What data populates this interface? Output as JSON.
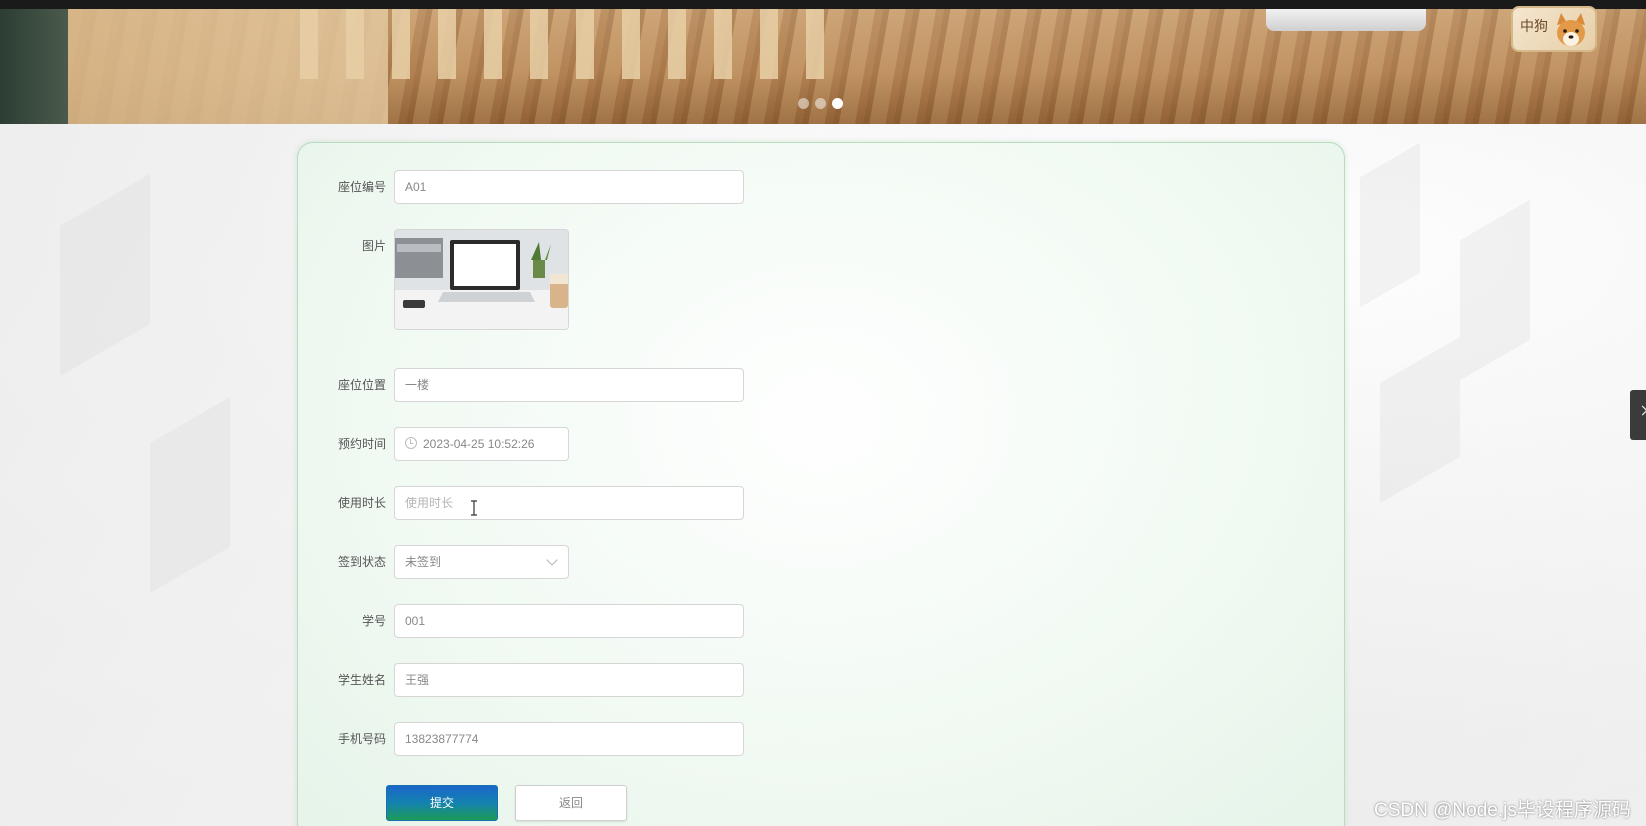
{
  "banner": {
    "slide_count": 3,
    "active_slide": 3
  },
  "logo": {
    "text": "中狗"
  },
  "form": {
    "fields": [
      {
        "label": "座位编号",
        "value": "A01"
      },
      {
        "label": "图片"
      },
      {
        "label": "座位位置",
        "value": "一楼"
      },
      {
        "label": "预约时间",
        "value": "2023-04-25 10:52:26"
      },
      {
        "label": "使用时长",
        "placeholder": "使用时长",
        "value": ""
      },
      {
        "label": "签到状态",
        "value": "未签到"
      },
      {
        "label": "学号",
        "value": "001"
      },
      {
        "label": "学生姓名",
        "value": "王强"
      },
      {
        "label": "手机号码",
        "value": "13823877774"
      }
    ],
    "submit_label": "提交",
    "back_label": "返回"
  },
  "watermark": "CSDN @Node.js毕设程序源码",
  "colors": {
    "card_border": "#b7dcc0",
    "submit_top": "#1b66c9",
    "submit_bottom": "#1c9a57"
  }
}
